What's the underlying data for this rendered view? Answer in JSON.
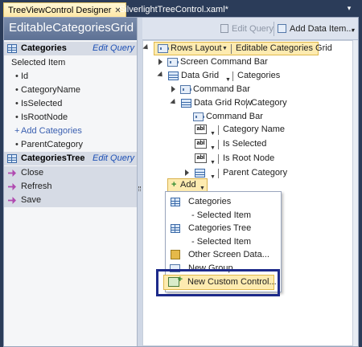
{
  "tabs": [
    {
      "label": "TreeViewControl Designer",
      "close": "✕"
    },
    {
      "label": "SilverlightTreeControl.xaml*"
    }
  ],
  "tab_menu_icon": "▾",
  "left": {
    "title": "EditableCategoriesGrid",
    "sections": [
      {
        "label": "Categories",
        "action": "Edit Query"
      },
      {
        "label": "Selected Item"
      },
      {
        "label": "Id"
      },
      {
        "label": "CategoryName"
      },
      {
        "label": "IsSelected"
      },
      {
        "label": "IsRootNode"
      },
      {
        "label": "Add Categories"
      },
      {
        "label": "ParentCategory"
      },
      {
        "label": "CategoriesTree",
        "action": "Edit Query"
      },
      {
        "label": "Close"
      },
      {
        "label": "Refresh"
      },
      {
        "label": "Save"
      }
    ]
  },
  "toolbar": {
    "edit_query": "Edit Query",
    "add_data_item": "Add Data Item..."
  },
  "tree": {
    "rows_layout": "Rows Layout",
    "rows_layout_name": "Editable Categories Grid",
    "screen_command_bar": "Screen Command Bar",
    "data_grid": "Data Grid",
    "data_grid_name": "Categories",
    "command_bar": "Command Bar",
    "data_grid_row": "Data Grid Row",
    "data_grid_row_name": "Category",
    "command_bar_inner": "Command Bar",
    "category_name": "Category Name",
    "is_selected": "Is Selected",
    "is_root_node": "Is Root Node",
    "parent_category": "Parent Category",
    "abl": "abl"
  },
  "add_button": {
    "label": "Add"
  },
  "add_menu": [
    {
      "label": "Categories"
    },
    {
      "label": "- Selected Item"
    },
    {
      "label": "Categories Tree"
    },
    {
      "label": "- Selected Item"
    },
    {
      "label": "Other Screen Data..."
    },
    {
      "label": "New Group"
    },
    {
      "label": "New Custom Control..."
    }
  ],
  "colors": {
    "accent_highlight": "#fdebb0",
    "annotation_box": "#1d2a8a",
    "panel_header": "#5d7194",
    "link_blue": "#1c4fb5"
  }
}
